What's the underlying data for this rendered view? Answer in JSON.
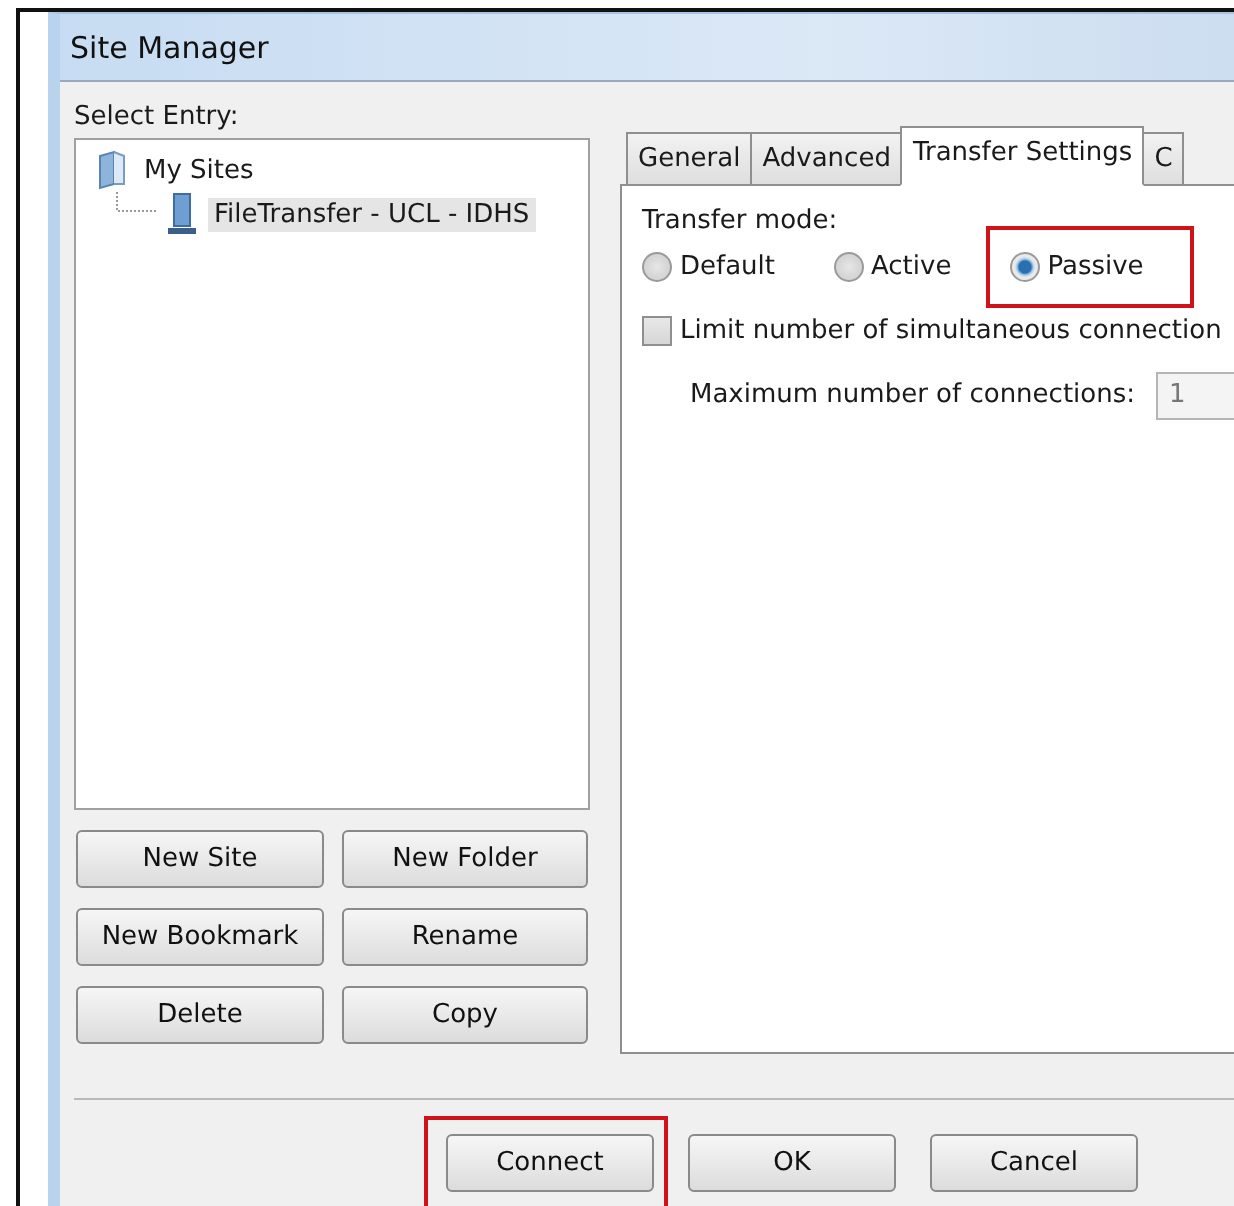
{
  "window": {
    "title": "Site Manager"
  },
  "select_entry": {
    "label": "Select Entry:",
    "tree": [
      {
        "label": "My Sites",
        "kind": "folder",
        "selected": false,
        "children": [
          {
            "label": "FileTransfer - UCL - IDHS",
            "kind": "server",
            "selected": true
          }
        ]
      }
    ]
  },
  "site_buttons": [
    {
      "label": "New Site"
    },
    {
      "label": "New Folder"
    },
    {
      "label": "New Bookmark"
    },
    {
      "label": "Rename"
    },
    {
      "label": "Delete"
    },
    {
      "label": "Copy"
    }
  ],
  "tabs": [
    {
      "label": "General",
      "selected": false
    },
    {
      "label": "Advanced",
      "selected": false
    },
    {
      "label": "Transfer Settings",
      "selected": true
    },
    {
      "label": "C",
      "selected": false
    }
  ],
  "transfer_settings": {
    "mode_label": "Transfer mode:",
    "modes": [
      {
        "label": "Default",
        "selected": false,
        "highlighted": false
      },
      {
        "label": "Active",
        "selected": false,
        "highlighted": false
      },
      {
        "label": "Passive",
        "selected": true,
        "highlighted": true
      }
    ],
    "limit": {
      "label": "Limit number of simultaneous connection",
      "checked": false
    },
    "max_connections": {
      "label": "Maximum number of connections:",
      "value": "1",
      "disabled": true
    }
  },
  "dialog_buttons": [
    {
      "label": "Connect",
      "highlighted": true
    },
    {
      "label": "OK",
      "highlighted": false
    },
    {
      "label": "Cancel",
      "highlighted": false
    }
  ]
}
